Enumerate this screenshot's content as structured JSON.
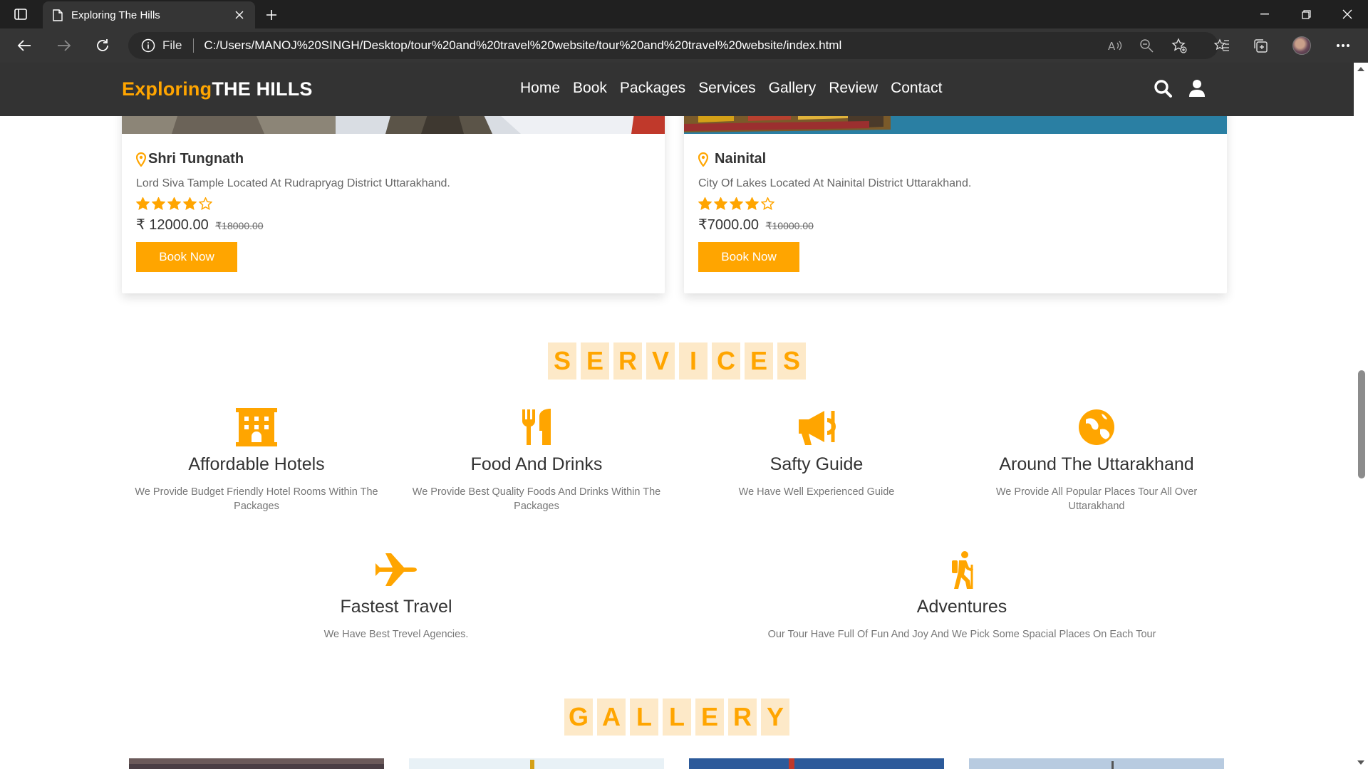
{
  "browser": {
    "tab_title": "Exploring The Hills",
    "url_scheme": "File",
    "url": "C:/Users/MANOJ%20SINGH/Desktop/tour%20and%20travel%20website/tour%20and%20travel%20website/index.html"
  },
  "site": {
    "logo_part1": "Exploring",
    "logo_part2": "THE HILLS",
    "nav": [
      "Home",
      "Book",
      "Packages",
      "Services",
      "Gallery",
      "Review",
      "Contact"
    ],
    "accent": "#ffa500",
    "header_bg": "#333333"
  },
  "packages": [
    {
      "title": "Shri Tungnath",
      "description": "Lord Siva Tample Located At Rudrapryag District Uttarakhand.",
      "rating": 4,
      "rating_max": 5,
      "price": "₹ 12000.00",
      "old_price": "₹18000.00",
      "button": "Book Now"
    },
    {
      "title": "Nainital",
      "description": "City Of Lakes Located At Nainital District Uttarakhand.",
      "rating": 4,
      "rating_max": 5,
      "price": "₹7000.00",
      "old_price": "₹10000.00",
      "button": "Book Now"
    }
  ],
  "services_heading": [
    "S",
    "E",
    "R",
    "V",
    "I",
    "C",
    "E",
    "S"
  ],
  "services": [
    {
      "icon": "hotel-icon",
      "title": "Affordable Hotels",
      "description": "We Provide Budget Friendly Hotel Rooms Within The Packages"
    },
    {
      "icon": "utensils-icon",
      "title": "Food And Drinks",
      "description": "We Provide Best Quality Foods And Drinks Within The Packages"
    },
    {
      "icon": "bullhorn-icon",
      "title": "Safty Guide",
      "description": "We Have Well Experienced Guide"
    },
    {
      "icon": "globe-icon",
      "title": "Around The Uttarakhand",
      "description": "We Provide All Popular Places Tour All Over Uttarakhand"
    },
    {
      "icon": "plane-icon",
      "title": "Fastest Travel",
      "description": "We Have Best Trevel Agencies."
    },
    {
      "icon": "hiking-icon",
      "title": "Adventures",
      "description": "Our Tour Have Full Of Fun And Joy And We Pick Some Spacial Places On Each Tour"
    }
  ],
  "gallery_heading": [
    "G",
    "A",
    "L",
    "L",
    "E",
    "R",
    "Y"
  ]
}
